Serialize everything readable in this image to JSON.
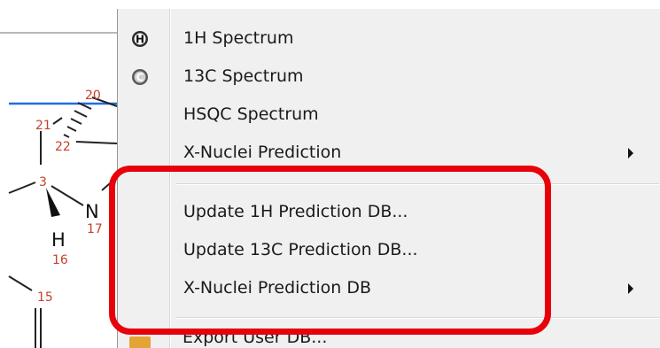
{
  "colors": {
    "menu_bg": "#f0f0f0",
    "highlight": "#e8000a",
    "bond_highlight": "#1f6fe0",
    "atom_number": "#c8402a"
  },
  "molecule": {
    "atom_numbers": [
      "20",
      "21",
      "22",
      "3",
      "17",
      "16",
      "15"
    ],
    "atoms": [
      "N",
      "H"
    ]
  },
  "menu": {
    "items": [
      {
        "label": "1H Spectrum",
        "icon": "h-spectrum-icon"
      },
      {
        "label": "13C Spectrum",
        "icon": "c-spectrum-icon"
      },
      {
        "label": "HSQC Spectrum"
      },
      {
        "label": "X-Nuclei Prediction",
        "submenu": true
      },
      {
        "label": "Update 1H Prediction DB..."
      },
      {
        "label": "Update 13C Prediction DB..."
      },
      {
        "label": "X-Nuclei Prediction DB",
        "submenu": true
      },
      {
        "label": "Export User DB..."
      }
    ]
  }
}
